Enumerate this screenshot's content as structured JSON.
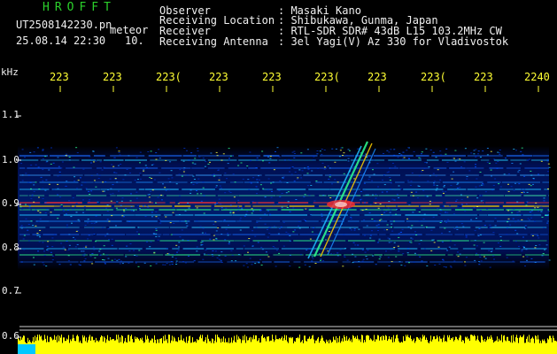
{
  "brand": "HROFFT",
  "file_name": "UT2508142230.pn",
  "meteor_label": "meteor",
  "datetime": "25.08.14 22:30",
  "interval": "10.",
  "info": [
    {
      "label": "Observer",
      "value": ": Masaki Kano"
    },
    {
      "label": "Receiving Location",
      "value": ": Shibukawa, Gunma, Japan"
    },
    {
      "label": "Receiver",
      "value": ": RTL-SDR SDR# 43dB L15 103.2MHz CW"
    },
    {
      "label": "Receiving Antenna",
      "value": ": 3el Yagi(V) Az 330 for Vladivostok"
    }
  ],
  "y_axis": {
    "unit": "kHz",
    "ticks": [
      "1.1",
      "1.0",
      "0.9",
      "0.8",
      "0.7",
      "0.6"
    ]
  },
  "x_axis": {
    "ticks": [
      "223",
      "223",
      "223(",
      "223",
      "223",
      "223(",
      "223",
      "223(",
      "223",
      "2240"
    ]
  },
  "colors": {
    "background": "#000000",
    "text": "#f0f0f0",
    "brand": "#2bd02b",
    "time_labels": "#ffff33",
    "noise_bar": "#ffff00",
    "noise_accent": "#00c8ff"
  }
}
